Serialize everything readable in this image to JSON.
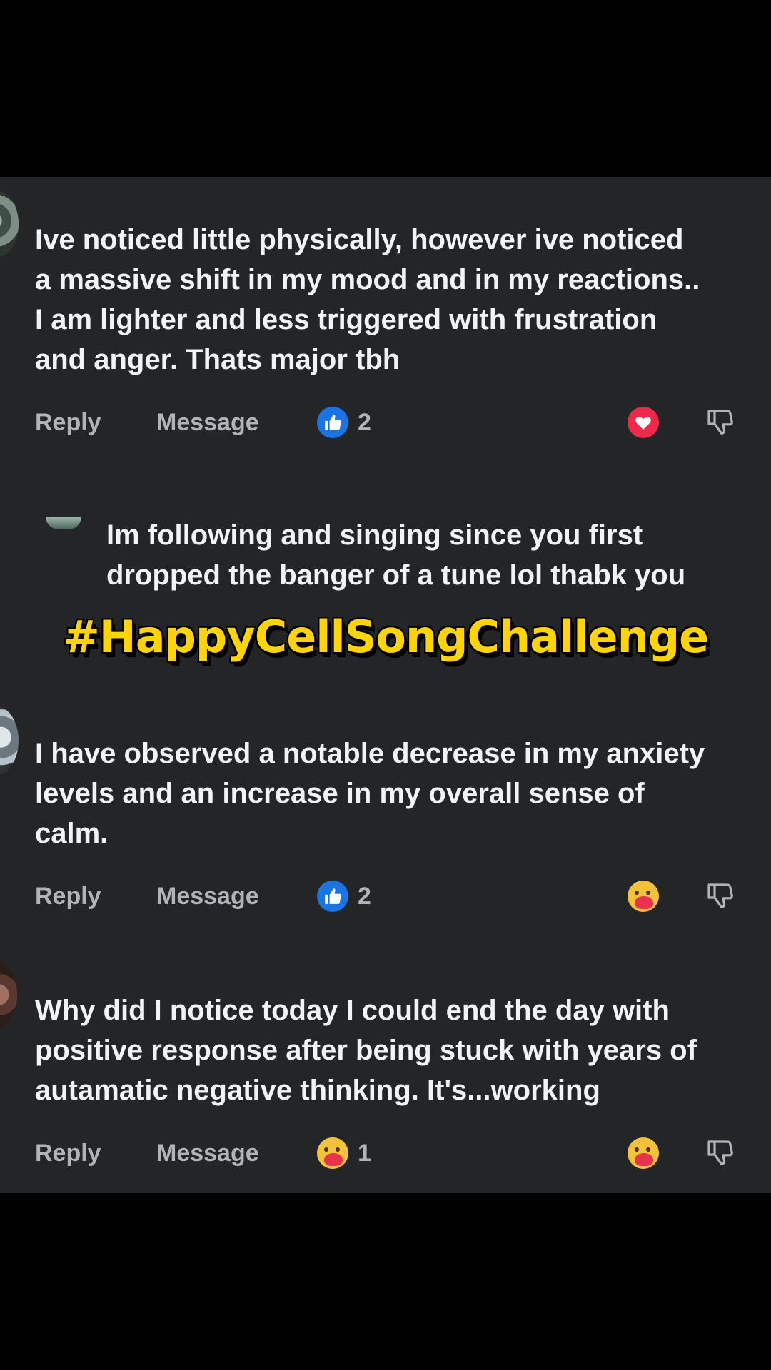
{
  "comments": [
    {
      "text": "Ive noticed little physically,  however ive noticed\na massive shift in my mood and in my reactions..\nI am lighter and less triggered with frustration\nand anger. Thats major tbh",
      "reply_label": "Reply",
      "message_label": "Message",
      "reaction_icon": "like-icon",
      "count": "2",
      "right_reaction": "love-icon"
    },
    {
      "text": "Im following and singing since you first\ndropped the banger of a tune lol  thabk you"
    },
    {
      "text": "I have observed a notable decrease in my anxiety\nlevels and an increase in my overall sense of\ncalm.",
      "reply_label": "Reply",
      "message_label": "Message",
      "reaction_icon": "like-icon",
      "count": "2",
      "right_reaction": "care-icon"
    },
    {
      "text": "Why did I notice today I could end the day with\npositive response after being stuck with years of\nautamatic negative thinking. It's...working",
      "reply_label": "Reply",
      "message_label": "Message",
      "reaction_icon": "care-icon",
      "count": "1",
      "right_reaction": "care-icon"
    }
  ],
  "overlay": {
    "hashtag": "#HappyCellSongChallenge"
  },
  "colors": {
    "background": "#000000",
    "panel": "#232527",
    "text": "#f2f3f5",
    "muted": "#b0b3b8",
    "like_blue": "#1b74e4",
    "love_red": "#f0284a",
    "hashtag_yellow": "#ffd400"
  }
}
